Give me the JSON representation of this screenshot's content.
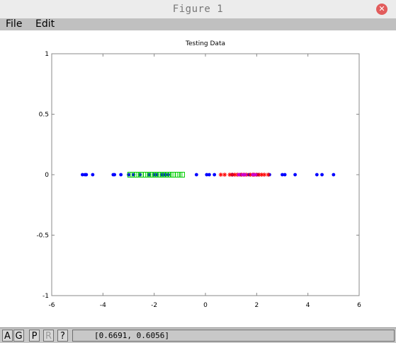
{
  "window": {
    "title": "Figure 1"
  },
  "menu": {
    "file": "File",
    "edit": "Edit"
  },
  "toolbar": {
    "btn_a": "A",
    "btn_g": "G",
    "btn_p": "P",
    "btn_r": "R",
    "btn_help": "?",
    "coords": "[0.6691, 0.6056]"
  },
  "colors": {
    "blue": "#0000ff",
    "green": "#00cc00",
    "red": "#ff0000",
    "magenta": "#cc00cc"
  },
  "chart_data": {
    "type": "scatter",
    "title": "Testing Data",
    "xlabel": "",
    "ylabel": "",
    "xlim": [
      -6,
      6
    ],
    "ylim": [
      -1,
      1
    ],
    "xticks": [
      -6,
      -4,
      -2,
      0,
      2,
      4,
      6
    ],
    "yticks": [
      -1,
      -0.5,
      0,
      0.5,
      1
    ],
    "series": [
      {
        "marker": "dot",
        "color": "#0000ff",
        "x": [
          -4.8,
          -4.7,
          -4.65,
          -4.4,
          -3.6,
          -3.55,
          -3.3,
          -3.0,
          -2.8,
          -2.55,
          -2.2,
          -2.0,
          -1.9,
          -1.7,
          -1.6,
          -1.55,
          -1.45,
          -0.35,
          0.05,
          0.15,
          0.35,
          1.05,
          1.35,
          1.7,
          2.05,
          2.5,
          3.0,
          3.1,
          3.5,
          4.35,
          4.55,
          5.0
        ],
        "y": [
          0,
          0,
          0,
          0,
          0,
          0,
          0,
          0,
          0,
          0,
          0,
          0,
          0,
          0,
          0,
          0,
          0,
          0,
          0,
          0,
          0,
          0,
          0,
          0,
          0,
          0,
          0,
          0,
          0,
          0,
          0,
          0
        ]
      },
      {
        "marker": "square",
        "color": "#00cc00",
        "x": [
          -2.95,
          -2.85,
          -2.7,
          -2.6,
          -2.5,
          -2.35,
          -2.25,
          -2.15,
          -2.05,
          -1.95,
          -1.85,
          -1.75,
          -1.65,
          -1.55,
          -1.45,
          -1.35,
          -1.25,
          -1.1,
          -1.0,
          -0.9
        ],
        "y": [
          0,
          0,
          0,
          0,
          0,
          0,
          0,
          0,
          0,
          0,
          0,
          0,
          0,
          0,
          0,
          0,
          0,
          0,
          0,
          0
        ]
      },
      {
        "marker": "star",
        "color": "#ff0000",
        "x": [
          0.6,
          0.75,
          0.95,
          1.05,
          1.15,
          1.25,
          1.4,
          1.5,
          1.6,
          1.75,
          1.85,
          1.9,
          2.0,
          2.1,
          2.2,
          2.3,
          2.45
        ],
        "y": [
          0,
          0,
          0,
          0,
          0,
          0,
          0,
          0,
          0,
          0,
          0,
          0,
          0,
          0,
          0,
          0,
          0
        ]
      },
      {
        "marker": "dot",
        "color": "#cc00cc",
        "x": [
          1.3,
          1.45,
          1.55,
          1.85,
          1.95
        ],
        "y": [
          0,
          0,
          0,
          0,
          0
        ]
      }
    ]
  }
}
